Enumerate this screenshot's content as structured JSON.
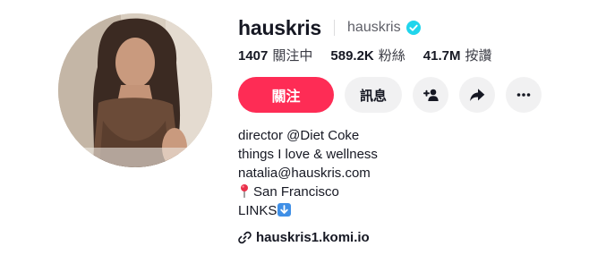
{
  "profile": {
    "username": "hauskris",
    "handle": "hauskris",
    "verified": true,
    "avatar_icon": "profile-photo"
  },
  "stats": [
    {
      "count": "1407",
      "label": "關注中"
    },
    {
      "count": "589.2K",
      "label": "粉絲"
    },
    {
      "count": "41.7M",
      "label": "按讚"
    }
  ],
  "actions": {
    "follow_label": "關注",
    "message_label": "訊息",
    "add_friend_icon": "person-plus-icon",
    "share_icon": "share-arrow-icon",
    "more_icon": "ellipsis-icon"
  },
  "bio": {
    "line1": "director @Diet Coke",
    "line2": "things I love & wellness",
    "line3": "natalia@hauskris.com",
    "line4": "San Francisco",
    "line4_icon": "pushpin-icon",
    "line5": "LINKS",
    "line5_icon": "down-arrow-emoji-icon"
  },
  "link": {
    "text": "hauskris1.komi.io",
    "icon": "link-icon"
  },
  "colors": {
    "follow_bg": "#fe2c55",
    "secondary_bg": "#f1f1f2",
    "verified": "#20d5ec",
    "text": "#161823"
  }
}
